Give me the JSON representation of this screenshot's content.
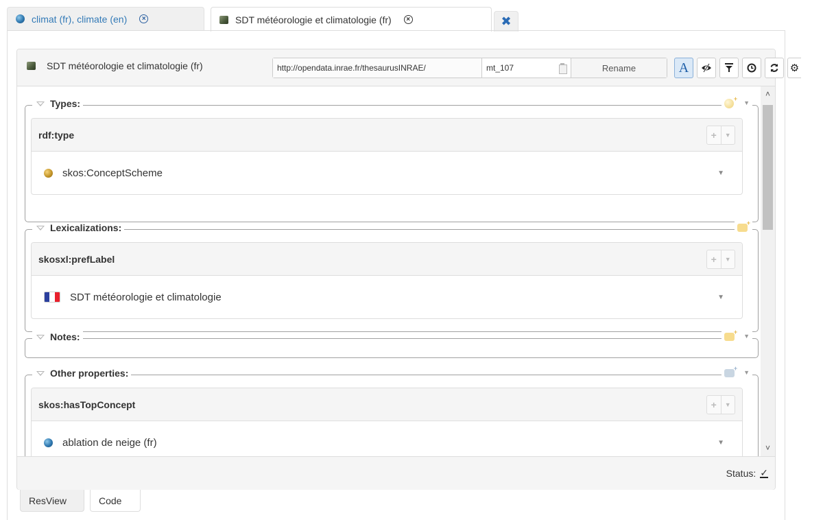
{
  "tabs": [
    {
      "label": "climat (fr), climate (en)",
      "icon": "concept-ball-icon",
      "active": false
    },
    {
      "label": "SDT météorologie et climatologie (fr)",
      "icon": "concept-scheme-icon",
      "active": true
    }
  ],
  "header": {
    "title": "SDT météorologie et climatologie (fr)",
    "uri_namespace": "http://opendata.inrae.fr/thesaurusINRAE/",
    "uri_local": "mt_107",
    "rename_label": "Rename",
    "tool_a_label": "A"
  },
  "sections": {
    "types": {
      "title": "Types:",
      "property": "rdf:type",
      "value": "skos:ConceptScheme"
    },
    "lexicalizations": {
      "title": "Lexicalizations:",
      "property": "skosxl:prefLabel",
      "value": "SDT météorologie et climatologie"
    },
    "notes": {
      "title": "Notes:"
    },
    "other": {
      "title": "Other properties:",
      "property": "skos:hasTopConcept",
      "value": "ablation de neige (fr)"
    }
  },
  "status": {
    "label": "Status:"
  },
  "bottom_tabs": [
    "ResView",
    "Code"
  ],
  "colors": {
    "link": "#337ab7",
    "accent": "#2a6bb5",
    "flag_blue": "#2b3f9e",
    "flag_red": "#e8202c"
  }
}
